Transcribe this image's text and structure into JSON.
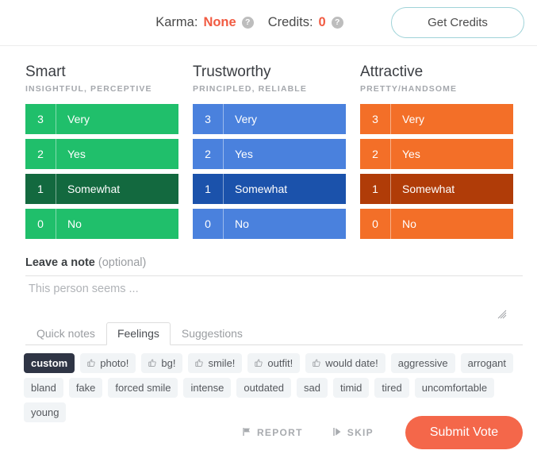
{
  "header": {
    "karma_label": "Karma:",
    "karma_value": "None",
    "credits_label": "Credits:",
    "credits_value": "0",
    "help_glyph": "?",
    "get_credits_label": "Get Credits",
    "value_color": "#f15b42",
    "button_border_color": "#9fd3d8"
  },
  "traits": [
    {
      "title": "Smart",
      "subtitle": "INSIGHTFUL, PERCEPTIVE",
      "color": "#20bf6b",
      "selected_color": "#13693f",
      "selected_value": "1",
      "options": [
        {
          "num": "3",
          "label": "Very"
        },
        {
          "num": "2",
          "label": "Yes"
        },
        {
          "num": "1",
          "label": "Somewhat"
        },
        {
          "num": "0",
          "label": "No"
        }
      ]
    },
    {
      "title": "Trustworthy",
      "subtitle": "PRINCIPLED, RELIABLE",
      "color": "#4a81dd",
      "selected_color": "#1b52ab",
      "selected_value": "1",
      "options": [
        {
          "num": "3",
          "label": "Very"
        },
        {
          "num": "2",
          "label": "Yes"
        },
        {
          "num": "1",
          "label": "Somewhat"
        },
        {
          "num": "0",
          "label": "No"
        }
      ]
    },
    {
      "title": "Attractive",
      "subtitle": "PRETTY/HANDSOME",
      "color": "#f36f28",
      "selected_color": "#b03c08",
      "selected_value": "1",
      "options": [
        {
          "num": "3",
          "label": "Very"
        },
        {
          "num": "2",
          "label": "Yes"
        },
        {
          "num": "1",
          "label": "Somewhat"
        },
        {
          "num": "0",
          "label": "No"
        }
      ]
    }
  ],
  "note": {
    "label_bold": "Leave a note",
    "label_optional": "(optional)",
    "placeholder": "This person seems ...",
    "value": ""
  },
  "tabs": [
    {
      "label": "Quick notes",
      "active": false
    },
    {
      "label": "Feelings",
      "active": true
    },
    {
      "label": "Suggestions",
      "active": false
    }
  ],
  "chips": [
    {
      "label": "custom",
      "style": "custom",
      "thumb": false
    },
    {
      "label": "photo!",
      "style": "normal",
      "thumb": true
    },
    {
      "label": "bg!",
      "style": "normal",
      "thumb": true
    },
    {
      "label": "smile!",
      "style": "normal",
      "thumb": true
    },
    {
      "label": "outfit!",
      "style": "normal",
      "thumb": true
    },
    {
      "label": "would date!",
      "style": "normal",
      "thumb": true
    },
    {
      "label": "aggressive",
      "style": "normal",
      "thumb": false
    },
    {
      "label": "arrogant",
      "style": "normal",
      "thumb": false
    },
    {
      "label": "bland",
      "style": "normal",
      "thumb": false
    },
    {
      "label": "fake",
      "style": "normal",
      "thumb": false
    },
    {
      "label": "forced smile",
      "style": "normal",
      "thumb": false
    },
    {
      "label": "intense",
      "style": "normal",
      "thumb": false
    },
    {
      "label": "outdated",
      "style": "normal",
      "thumb": false
    },
    {
      "label": "sad",
      "style": "normal",
      "thumb": false
    },
    {
      "label": "timid",
      "style": "normal",
      "thumb": false
    },
    {
      "label": "tired",
      "style": "normal",
      "thumb": false
    },
    {
      "label": "uncomfortable",
      "style": "normal",
      "thumb": false
    },
    {
      "label": "young",
      "style": "normal",
      "thumb": false
    }
  ],
  "actions": {
    "report_label": "REPORT",
    "skip_label": "SKIP",
    "submit_label": "Submit Vote",
    "submit_color": "#f4674a"
  }
}
